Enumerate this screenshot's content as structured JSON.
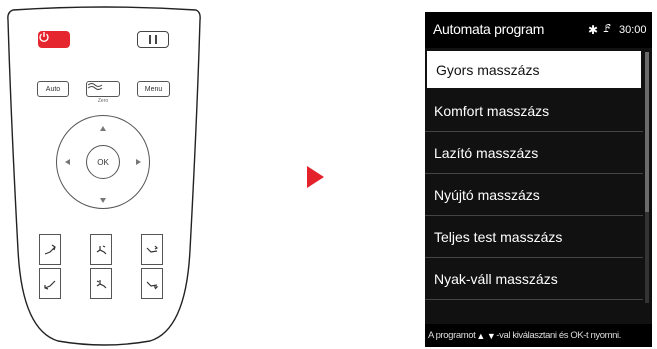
{
  "remote": {
    "power_icon": "power-icon",
    "pause_icon": "pause-icon",
    "auto_label": "Auto",
    "zero_label": "Zero",
    "menu_label": "Menu",
    "ok_label": "OK"
  },
  "screen": {
    "title": "Automata program",
    "bluetooth_icon": "bluetooth-icon",
    "heat_icon": "heat-icon",
    "time": "30:00",
    "items": [
      {
        "label": "Gyors masszázs",
        "selected": true
      },
      {
        "label": "Komfort masszázs",
        "selected": false
      },
      {
        "label": "Lazító masszázs",
        "selected": false
      },
      {
        "label": "Nyújtó masszázs",
        "selected": false
      },
      {
        "label": "Teljes test masszázs",
        "selected": false
      },
      {
        "label": "Nyak-váll masszázs",
        "selected": false
      }
    ],
    "footer_pre": "A programot",
    "footer_post": "-val kiválasztani és OK-t nyomni.",
    "accent": "#e3222c"
  }
}
